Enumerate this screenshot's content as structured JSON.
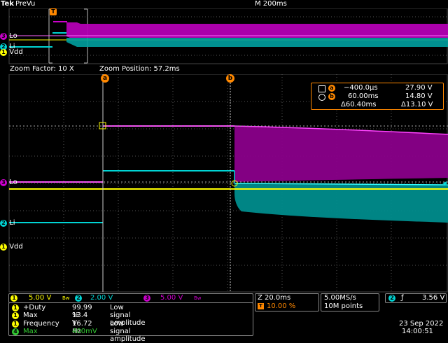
{
  "header": {
    "brand": "Tek",
    "mode": "PreVu",
    "timebase": "M 200ms"
  },
  "preview": {
    "trigger_marker": "T",
    "channel_labels": [
      {
        "badge": "3",
        "text": "Lo"
      },
      {
        "badge": "2",
        "text": "Li"
      },
      {
        "badge": "1",
        "text": "Vdd"
      }
    ]
  },
  "zoom": {
    "factor": "Zoom Factor: 10 X",
    "position": "Zoom Position: 57.2ms"
  },
  "main_labels": [
    {
      "badge": "3",
      "text": "Lo"
    },
    {
      "badge": "2",
      "text": "Li"
    },
    {
      "badge": "1",
      "text": "Vdd"
    }
  ],
  "cursors": {
    "a_marker": "a",
    "b_marker": "b",
    "readout": {
      "a_time": "−400.0µs",
      "a_volt": "27.90 V",
      "b_time": "60.00ms",
      "b_volt": "14.80 V",
      "delta_time": "Δ60.40ms",
      "delta_volt": "Δ13.10 V"
    }
  },
  "bottom": {
    "ch1": {
      "badge": "1",
      "value": "5.00 V",
      "bw": "Bw"
    },
    "ch2": {
      "badge": "2",
      "value": "2.00 V"
    },
    "ch3": {
      "badge": "3",
      "value": "5.00 V",
      "bw": "Bw"
    },
    "zoom_time": "Z 20.0ms",
    "trigger_pos": "10.00 %",
    "sample_rate": "5.00MS/s",
    "record_length": "10M points",
    "trig_source": "2",
    "trig_slope": "ƒ",
    "trig_level": "3.56 V",
    "date": "23 Sep  2022",
    "time": "14:00:51"
  },
  "measurements": [
    {
      "badge": "1",
      "name": "+Duty",
      "value": "99.99 %",
      "note": "Low signal amplitude"
    },
    {
      "badge": "1",
      "name": "Max",
      "value": "13.4 V",
      "note": ""
    },
    {
      "badge": "1",
      "name": "Frequency",
      "value": "16.72 Hz",
      "note": "Low signal amplitude"
    },
    {
      "badge": "4",
      "name": "Max",
      "value": "400mV",
      "note": ""
    }
  ],
  "colors": {
    "ch1": "#ffff00",
    "ch2": "#00d4d4",
    "ch3": "#cc00cc",
    "ch4": "#33cc33",
    "cursor": "#ff8800",
    "grid": "#666666"
  }
}
